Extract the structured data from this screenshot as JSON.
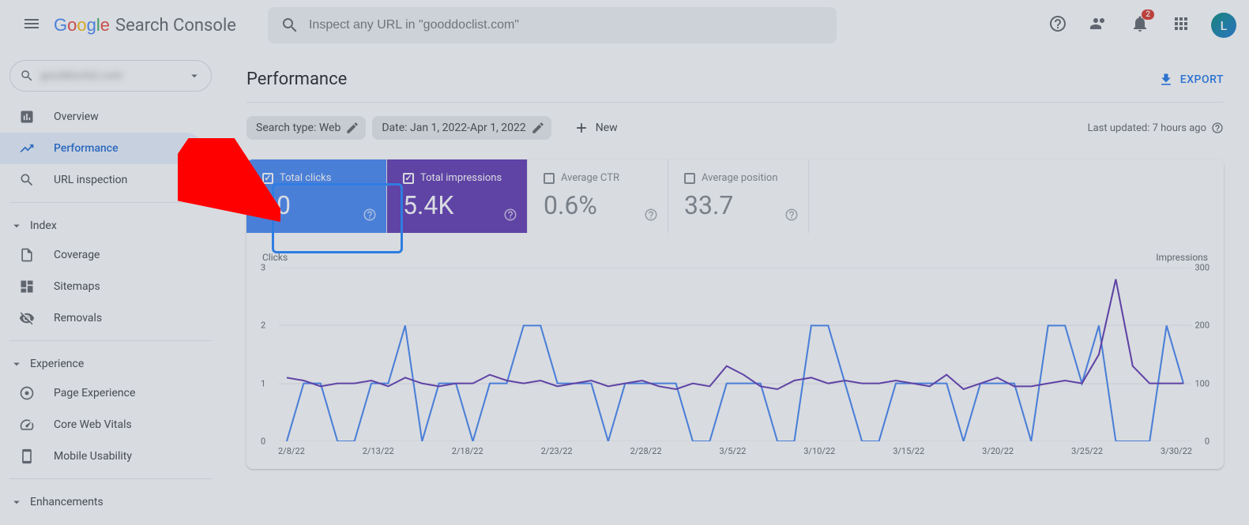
{
  "header": {
    "product_name": "Search Console",
    "search_placeholder": "Inspect any URL in \"gooddoclist.com\"",
    "notification_count": "2",
    "avatar_letter": "L"
  },
  "sidebar": {
    "property_label": "gooddoclist.com",
    "items": {
      "overview": "Overview",
      "performance": "Performance",
      "url_inspection": "URL inspection"
    },
    "index_section": "Index",
    "index_items": {
      "coverage": "Coverage",
      "sitemaps": "Sitemaps",
      "removals": "Removals"
    },
    "experience_section": "Experience",
    "experience_items": {
      "page_experience": "Page Experience",
      "core_web_vitals": "Core Web Vitals",
      "mobile_usability": "Mobile Usability"
    },
    "enhancements_section": "Enhancements"
  },
  "main": {
    "title": "Performance",
    "export": "EXPORT",
    "filters": {
      "search_type": "Search type: Web",
      "date": "Date: Jan 1, 2022-Apr 1, 2022",
      "new": "New"
    },
    "last_updated": "Last updated: 7 hours ago",
    "metrics": {
      "clicks_label": "Total clicks",
      "clicks_value": "30",
      "impressions_label": "Total impressions",
      "impressions_value": "5.4K",
      "ctr_label": "Average CTR",
      "ctr_value": "0.6%",
      "position_label": "Average position",
      "position_value": "33.7"
    },
    "chart": {
      "left_title": "Clicks",
      "right_title": "Impressions",
      "y_left": [
        "3",
        "2",
        "1",
        "0"
      ],
      "y_right": [
        "300",
        "200",
        "100",
        "0"
      ],
      "x_labels": [
        "2/8/22",
        "2/13/22",
        "2/18/22",
        "2/23/22",
        "2/28/22",
        "3/5/22",
        "3/10/22",
        "3/15/22",
        "3/20/22",
        "3/25/22",
        "3/30/22"
      ]
    }
  },
  "chart_data": {
    "type": "line",
    "title": "Performance",
    "x_dates": [
      "2/8/22",
      "2/13/22",
      "2/18/22",
      "2/23/22",
      "2/28/22",
      "3/5/22",
      "3/10/22",
      "3/15/22",
      "3/20/22",
      "3/25/22",
      "3/30/22"
    ],
    "series": [
      {
        "name": "Clicks",
        "axis": "left",
        "ylim": [
          0,
          3
        ],
        "approx_daily_values": [
          0,
          1,
          1,
          0,
          0,
          1,
          1,
          2,
          0,
          1,
          1,
          0,
          1,
          1,
          2,
          2,
          1,
          1,
          1,
          0,
          1,
          1,
          1,
          1,
          0,
          0,
          1,
          1,
          1,
          0,
          0,
          2,
          2,
          1,
          0,
          0,
          1,
          1,
          1,
          1,
          0,
          1,
          1,
          1,
          0,
          2,
          2,
          1,
          2,
          0,
          0,
          0,
          2,
          1
        ]
      },
      {
        "name": "Impressions",
        "axis": "right",
        "ylim": [
          0,
          300
        ],
        "approx_daily_values": [
          110,
          105,
          95,
          100,
          100,
          105,
          95,
          110,
          100,
          95,
          100,
          100,
          115,
          105,
          100,
          105,
          95,
          100,
          105,
          95,
          100,
          105,
          95,
          90,
          100,
          95,
          130,
          115,
          95,
          90,
          105,
          110,
          100,
          105,
          100,
          100,
          105,
          100,
          95,
          115,
          90,
          100,
          110,
          95,
          95,
          100,
          105,
          100,
          150,
          280,
          130,
          100,
          100,
          100
        ]
      }
    ]
  }
}
